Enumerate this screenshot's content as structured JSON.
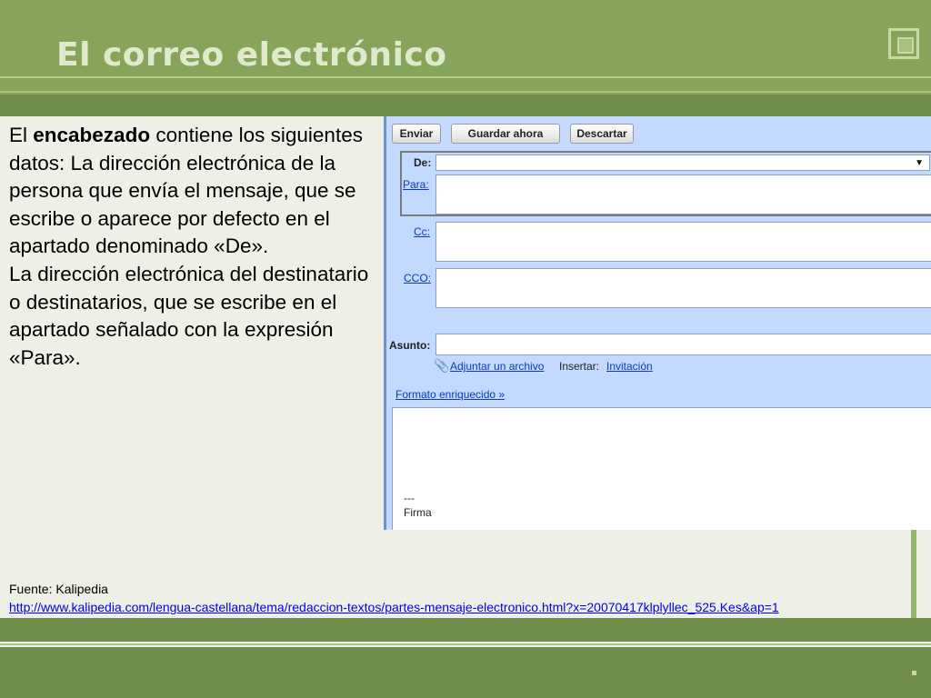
{
  "slide": {
    "title": "El correo electrónico",
    "body": {
      "p1_a": "El ",
      "p1_bold": "encabezado",
      "p1_b": " contiene los siguientes datos: La dirección electrónica de la persona que envía el mensaje, que se escribe o aparece por defecto en el apartado denominado «De».",
      "p2": "La dirección electrónica del destinatario o destinatarios, que se escribe en el apartado señalado con la expresión «Para»."
    },
    "source_label": "Fuente: Kalipedia",
    "source_url": "http://www.kalipedia.com/lengua-castellana/tema/redaccion-textos/partes-mensaje-electronico.html?x=20070417klplyllec_525.Kes&ap=1"
  },
  "mail": {
    "buttons": {
      "send": "Enviar",
      "save": "Guardar ahora",
      "discard": "Descartar"
    },
    "labels": {
      "from": "De:",
      "to": "Para:",
      "cc": "Cc:",
      "bcc": "CCO:",
      "subject": "Asunto:"
    },
    "attach": "Adjuntar un archivo",
    "insert_label": "Insertar:",
    "insert_link": "Invitación",
    "rich_format": "Formato enriquecido »",
    "signature_sep": "---",
    "signature": "Firma"
  },
  "colors": {
    "header": "#86a55a",
    "header_dark": "#6f8e4b",
    "mail_bg": "#c3d9ff",
    "link": "#0b3bb5"
  }
}
